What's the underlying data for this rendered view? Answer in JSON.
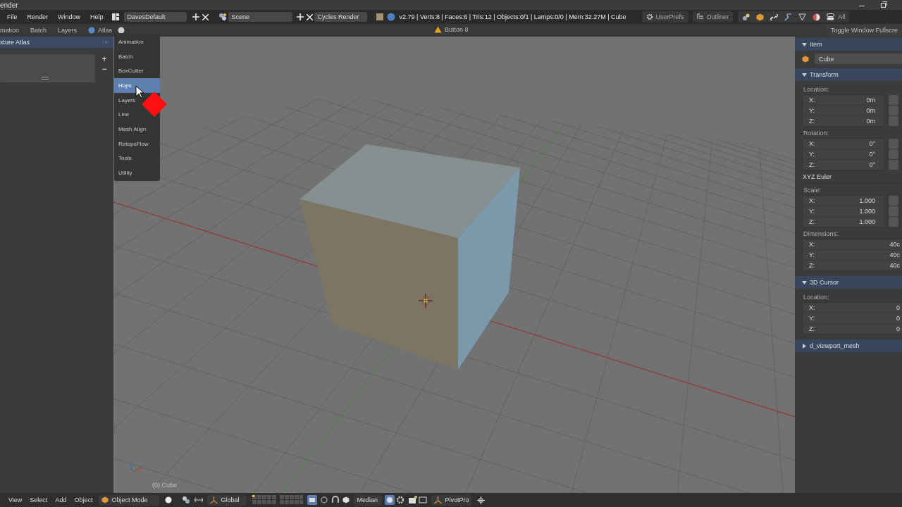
{
  "title_bar": {
    "title": "ender"
  },
  "menus": [
    "File",
    "Render",
    "Window",
    "Help"
  ],
  "layout_field": "DavesDefault",
  "scene_field": "Scene",
  "render_engine": "Cycles Render",
  "stats": "v2.79 | Verts:8 | Faces:6 | Tris:12 | Objects:0/1 | Lamps:0/0 | Mem:32.27M | Cube",
  "editor_buttons": [
    "UserPrefs",
    "Outliner"
  ],
  "context_filter": "All",
  "tool_tabs": [
    "mation",
    "Batch",
    "Layers"
  ],
  "atlas_tab": "Atlas",
  "status_message": "Button 8",
  "fullscreen_button": "Toggle Window Fullscre",
  "left_panel": {
    "title": "xture Atlas",
    "list_buttons": [
      "+",
      "−"
    ]
  },
  "tab_menu": {
    "items": [
      {
        "label": "Animation",
        "selected": false
      },
      {
        "label": "Batch",
        "selected": false
      },
      {
        "label": "BoxCutter",
        "selected": false
      },
      {
        "label": "Hops",
        "selected": true
      },
      {
        "label": "Layers",
        "selected": false
      },
      {
        "label": "Line",
        "selected": false
      },
      {
        "label": "Mesh Align",
        "selected": false
      },
      {
        "label": "RetopoFlow",
        "selected": false
      },
      {
        "label": "Tools",
        "selected": false
      },
      {
        "label": "Utility",
        "selected": false
      }
    ]
  },
  "viewport": {
    "object_label": "(0) Cube"
  },
  "properties": {
    "sections": [
      {
        "title": "Item",
        "expanded": true,
        "blocks": [
          {
            "kind": "name",
            "value": "Cube"
          }
        ]
      },
      {
        "title": "Transform",
        "expanded": true,
        "blocks": [
          {
            "kind": "fields",
            "label": "Location:",
            "locks": true,
            "rows": [
              {
                "axis": "X:",
                "value": "0m"
              },
              {
                "axis": "Y:",
                "value": "0m"
              },
              {
                "axis": "Z:",
                "value": "0m"
              }
            ]
          },
          {
            "kind": "fields",
            "label": "Rotation:",
            "locks": true,
            "rows": [
              {
                "axis": "X:",
                "value": "0°"
              },
              {
                "axis": "Y:",
                "value": "0°"
              },
              {
                "axis": "Z:",
                "value": "0°"
              }
            ]
          },
          {
            "kind": "dropdown",
            "value": "XYZ Euler"
          },
          {
            "kind": "fields",
            "label": "Scale:",
            "locks": true,
            "rows": [
              {
                "axis": "X:",
                "value": "1.000"
              },
              {
                "axis": "Y:",
                "value": "1.000"
              },
              {
                "axis": "Z:",
                "value": "1.000"
              }
            ]
          },
          {
            "kind": "fields",
            "label": "Dimensions:",
            "locks": false,
            "rows": [
              {
                "axis": "X:",
                "value": "40c"
              },
              {
                "axis": "Y:",
                "value": "40c"
              },
              {
                "axis": "Z:",
                "value": "40c"
              }
            ]
          }
        ]
      },
      {
        "title": "3D Cursor",
        "expanded": true,
        "blocks": [
          {
            "kind": "fields",
            "label": "Location:",
            "locks": false,
            "rows": [
              {
                "axis": "X:",
                "value": "0"
              },
              {
                "axis": "Y:",
                "value": "0"
              },
              {
                "axis": "Z:",
                "value": "0"
              }
            ]
          }
        ]
      },
      {
        "title": "d_viewport_mesh",
        "expanded": false
      }
    ]
  },
  "bottom_bar": {
    "menus": [
      "View",
      "Select",
      "Add",
      "Object"
    ],
    "mode": "Object Mode",
    "orientation": "Global",
    "pivot": "Median",
    "pivot_addon": "PivotPro"
  }
}
